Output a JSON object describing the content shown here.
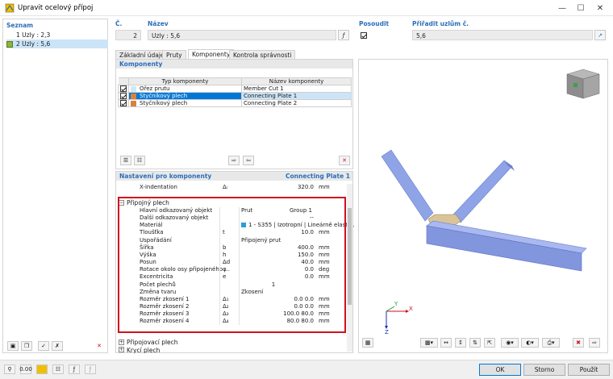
{
  "window": {
    "title": "Upravit ocelový přípoj"
  },
  "list": {
    "title": "Seznam",
    "items": [
      {
        "label": "1  Uzly : 2,3",
        "color": "#ffffff"
      },
      {
        "label": "2  Uzly : 5,6",
        "color": "#8db53b"
      }
    ]
  },
  "header": {
    "number_label": "Č.",
    "number_value": "2",
    "name_label": "Název",
    "name_value": "Uzly : 5,6",
    "assess_label": "Posoudit",
    "assign_label": "Přiřadit uzlům č.",
    "assign_value": "5,6"
  },
  "tabs": [
    {
      "label": "Základní údaje"
    },
    {
      "label": "Pruty"
    },
    {
      "label": "Komponenty"
    },
    {
      "label": "Kontrola správnosti"
    }
  ],
  "components": {
    "title": "Komponenty",
    "col_type": "Typ komponenty",
    "col_name": "Název komponenty",
    "rows": [
      {
        "type": "Ořez prutu",
        "name": "Member Cut 1",
        "color": "#cfe8f8"
      },
      {
        "type": "Styčníkový plech",
        "name": "Connecting Plate 1",
        "color": "#d9823b"
      },
      {
        "type": "Styčníkový plech",
        "name": "Connecting Plate 2",
        "color": "#d9823b"
      }
    ]
  },
  "settings": {
    "title": "Nastavení pro komponenty",
    "component_name": "Connecting Plate 1",
    "xind_label": "X-indentation",
    "xind_sym": "Δᵢ",
    "xind_value": "320.0",
    "xind_unit": "mm",
    "group_title": "Připojný plech",
    "rows": [
      {
        "name": "Hlavní odkazovaný objekt",
        "sym": "",
        "value": "Prut",
        "unit": "Group 1"
      },
      {
        "name": "Další odkazovaný objekt",
        "sym": "",
        "value": "--",
        "unit": ""
      },
      {
        "name": "Materiál",
        "sym": "",
        "value": "1 - S355 | Izotropní | Lineárně elasti...",
        "unit": ""
      },
      {
        "name": "Tloušťka",
        "sym": "t",
        "value": "10.0",
        "unit": "mm"
      },
      {
        "name": "Uspořádání",
        "sym": "",
        "value": "Připojený prut",
        "unit": ""
      },
      {
        "name": "Šířka",
        "sym": "b",
        "value": "400.0",
        "unit": "mm"
      },
      {
        "name": "Výška",
        "sym": "h",
        "value": "150.0",
        "unit": "mm"
      },
      {
        "name": "Posun",
        "sym": "Δd",
        "value": "40.0",
        "unit": "mm"
      },
      {
        "name": "Rotace okolo osy připojeného ...",
        "sym": "φ",
        "value": "0.0",
        "unit": "deg"
      },
      {
        "name": "Excentricita",
        "sym": "e",
        "value": "0.0",
        "unit": "mm"
      },
      {
        "name": "Počet plechů",
        "sym": "",
        "value": "1",
        "unit": ""
      },
      {
        "name": "Změna tvaru",
        "sym": "",
        "value": "Zkosení",
        "unit": ""
      },
      {
        "name": "Rozměr zkosení 1",
        "sym": "Δ₁",
        "value": "0.0 0.0",
        "unit": "mm"
      },
      {
        "name": "Rozměr zkosení 2",
        "sym": "Δ₂",
        "value": "0.0 0.0",
        "unit": "mm"
      },
      {
        "name": "Rozměr zkosení 3",
        "sym": "Δ₃",
        "value": "100.0 80.0",
        "unit": "mm"
      },
      {
        "name": "Rozměr zkosení 4",
        "sym": "Δ₄",
        "value": "80.0 80.0",
        "unit": "mm"
      }
    ],
    "collapsed_1": "Připojovací plech",
    "collapsed_2": "Krycí plech"
  },
  "axes": {
    "x": "X",
    "y": "Y",
    "z": "Z"
  },
  "buttons": {
    "ok": "OK",
    "cancel": "Storno",
    "apply": "Použít"
  },
  "colors": {
    "accent": "#2a6ebb",
    "highlight": "#cce4f7",
    "selected_row": "#0078d7",
    "red": "#d0101f"
  }
}
